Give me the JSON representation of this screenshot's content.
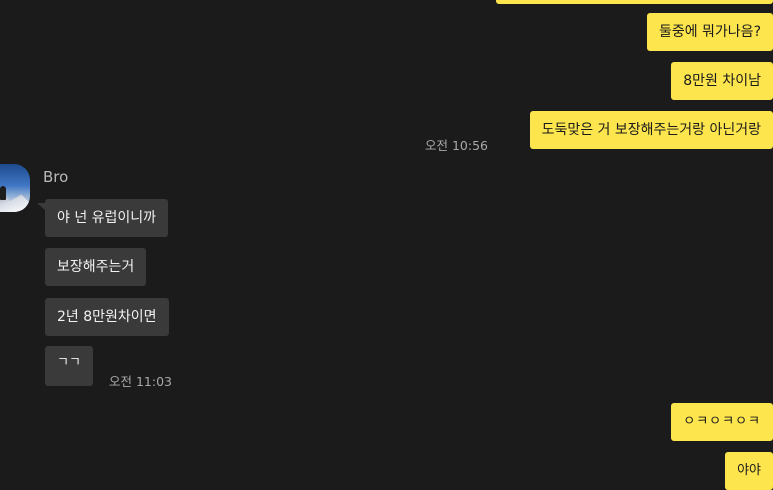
{
  "messages_top": [
    {
      "text": "둘중에 뭐가나음?"
    },
    {
      "text": "8만원 차이남"
    },
    {
      "text": "도둑맞은 거 보장해주는거랑 아닌거랑"
    }
  ],
  "time_1": "오전 10:56",
  "friend": {
    "name": "Bro",
    "messages": [
      {
        "text": "야 넌 유럽이니까"
      },
      {
        "text": "보장해주는거"
      },
      {
        "text": "2년 8만원차이면"
      },
      {
        "text": "ㄱㄱ"
      }
    ],
    "time": "오전 11:03"
  },
  "messages_bottom": [
    {
      "text": "ㅇㅋㅇㅋㅇㅋ"
    },
    {
      "text": "야야"
    }
  ],
  "colors": {
    "background": "#1b1b1b",
    "my_bubble": "#fde54e",
    "their_bubble": "#3a3a3a"
  }
}
